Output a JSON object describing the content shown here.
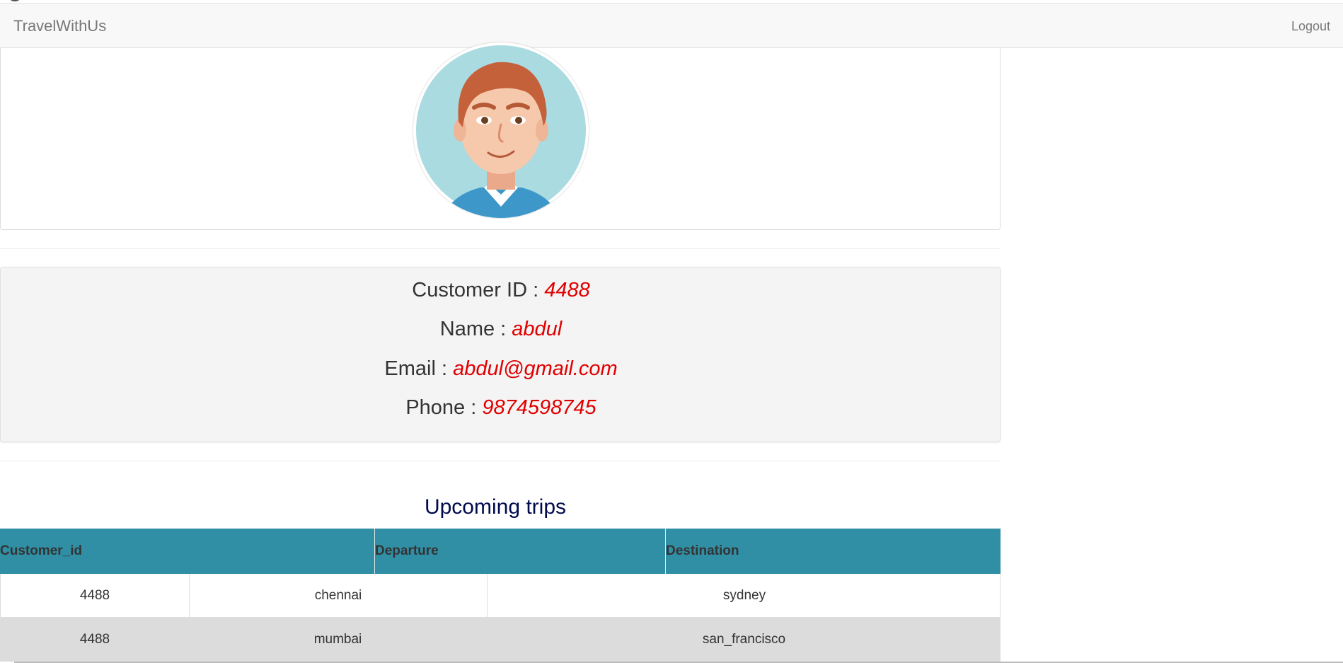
{
  "navbar": {
    "brand": "TravelWithUs",
    "logout_label": "Logout"
  },
  "profile": {
    "avatar_icon": "user-avatar-illustration",
    "customer_id_label": "Customer ID : ",
    "customer_id": "4488",
    "name_label": "Name : ",
    "name": "abdul",
    "email_label": "Email : ",
    "email": "abdul@gmail.com",
    "phone_label": "Phone : ",
    "phone": "9874598745"
  },
  "trips": {
    "title": "Upcoming trips",
    "columns": [
      "Customer_id",
      "Departure",
      "Destination"
    ],
    "rows": [
      [
        "4488",
        "chennai",
        "sydney"
      ],
      [
        "4488",
        "mumbai",
        "san_francisco"
      ]
    ]
  },
  "colors": {
    "header_bg": "#318fa5",
    "value_text": "#e00000",
    "title_text": "#000a4d"
  }
}
